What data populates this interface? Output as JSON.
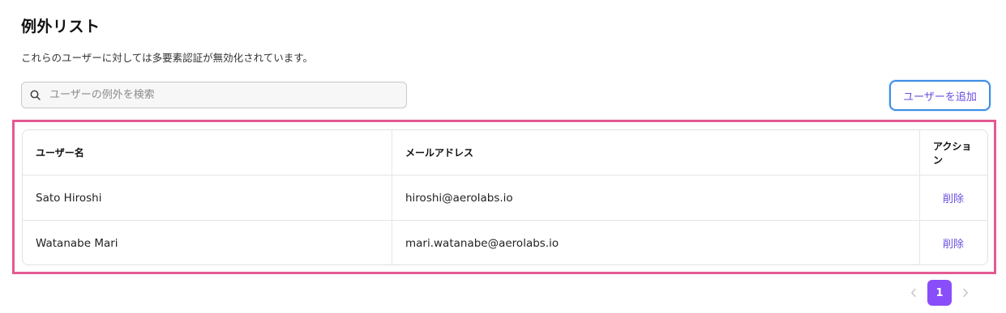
{
  "header": {
    "title": "例外リスト",
    "description": "これらのユーザーに対しては多要素認証が無効化されています。"
  },
  "search": {
    "placeholder": "ユーザーの例外を検索",
    "icon": "search-icon"
  },
  "toolbar": {
    "add_user_label": "ユーザーを追加"
  },
  "table": {
    "columns": [
      "ユーザー名",
      "メールアドレス",
      "アクション"
    ],
    "rows": [
      {
        "name": "Sato Hiroshi",
        "email": "hiroshi@aerolabs.io",
        "action": "削除"
      },
      {
        "name": "Watanabe Mari",
        "email": "mari.watanabe@aerolabs.io",
        "action": "削除"
      }
    ]
  },
  "pagination": {
    "current_page": "1",
    "prev_icon": "chevron-left-icon",
    "next_icon": "chevron-right-icon"
  },
  "colors": {
    "accent": "#8a4dfa",
    "link": "#6a4de0",
    "focus_border": "#3b8fe5",
    "highlight": "#e45a92"
  }
}
